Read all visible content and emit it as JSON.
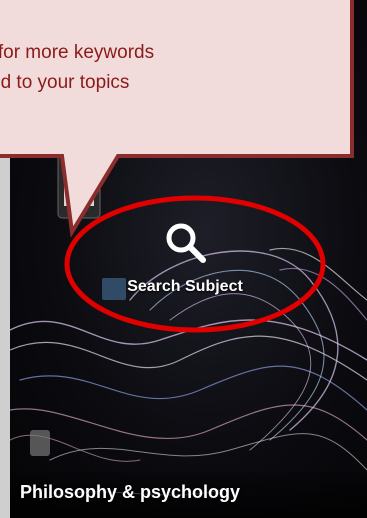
{
  "callout": {
    "line1": "e for more keywords",
    "line2": "ed to your topics"
  },
  "tile": {
    "search_label": "Search Subject",
    "subject_title": "Philosophy & psychology"
  },
  "colors": {
    "callout_fill": "#f2dcdb",
    "callout_border": "#8b2d2d",
    "callout_text": "#8b1a1a",
    "highlight_ring": "#e00000"
  },
  "icons": {
    "search": "magnifier-icon"
  }
}
